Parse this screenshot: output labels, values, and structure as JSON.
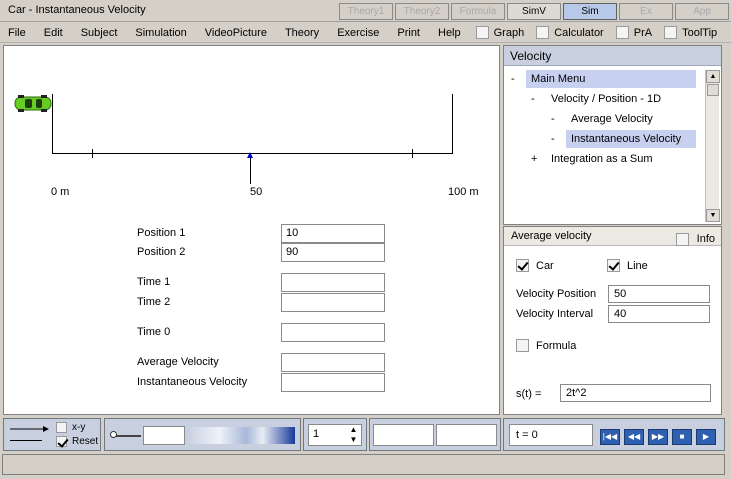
{
  "window": {
    "title": "Car - Instantaneous Velocity",
    "tabs": [
      "Theory1",
      "Theory2",
      "Formula",
      "SimV",
      "Sim",
      "Ex",
      "App"
    ]
  },
  "menu": {
    "items": [
      "File",
      "Edit",
      "Subject",
      "Simulation",
      "VideoPicture",
      "Theory",
      "Exercise",
      "Print",
      "Help"
    ],
    "toggles": [
      "Graph",
      "Calculator",
      "PrA",
      "ToolTip"
    ]
  },
  "sim": {
    "axis_labels": [
      "0 m",
      "50",
      "100 m"
    ],
    "marker_position_m": 50,
    "form": {
      "position1_label": "Position 1",
      "position1_value": "10",
      "position2_label": "Position 2",
      "position2_value": "90",
      "time1_label": "Time 1",
      "time1_value": "",
      "time2_label": "Time 2",
      "time2_value": "",
      "time0_label": "Time 0",
      "time0_value": "",
      "avg_velocity_label": "Average Velocity",
      "avg_velocity_value": "",
      "inst_velocity_label": "Instantaneous Velocity",
      "inst_velocity_value": ""
    }
  },
  "velocity_panel": {
    "header": "Velocity",
    "tree": [
      {
        "mark": "-",
        "label": "Main Menu",
        "selected": true
      },
      {
        "mark": "-",
        "label": "Velocity / Position - 1D",
        "selected": false
      },
      {
        "mark": "-",
        "label": "Average Velocity",
        "selected": false
      },
      {
        "mark": "-",
        "label": "Instantaneous Velocity",
        "selected": true
      },
      {
        "mark": "+",
        "label": "Integration as a Sum",
        "selected": false
      }
    ]
  },
  "avg_panel": {
    "header": "Average velocity",
    "info_label": "Info",
    "car_label": "Car",
    "car_checked": true,
    "line_label": "Line",
    "line_checked": true,
    "velocity_position_label": "Velocity Position",
    "velocity_position_value": "50",
    "velocity_interval_label": "Velocity Interval",
    "velocity_interval_value": "40",
    "formula_label": "Formula",
    "formula_checked": false,
    "st_label": "s(t) =",
    "st_value": "2t^2"
  },
  "toolbar": {
    "xy_label": "x-y",
    "reset_label": "Reset",
    "reset_checked": true,
    "spinner_value": "1",
    "time_display": "t = 0"
  },
  "colors": {
    "header_blue": "#c8d0e0",
    "selection": "#c8d0f0",
    "marker": "#0000cc",
    "car": "#66cc22",
    "nav_button": "#3060b0"
  }
}
